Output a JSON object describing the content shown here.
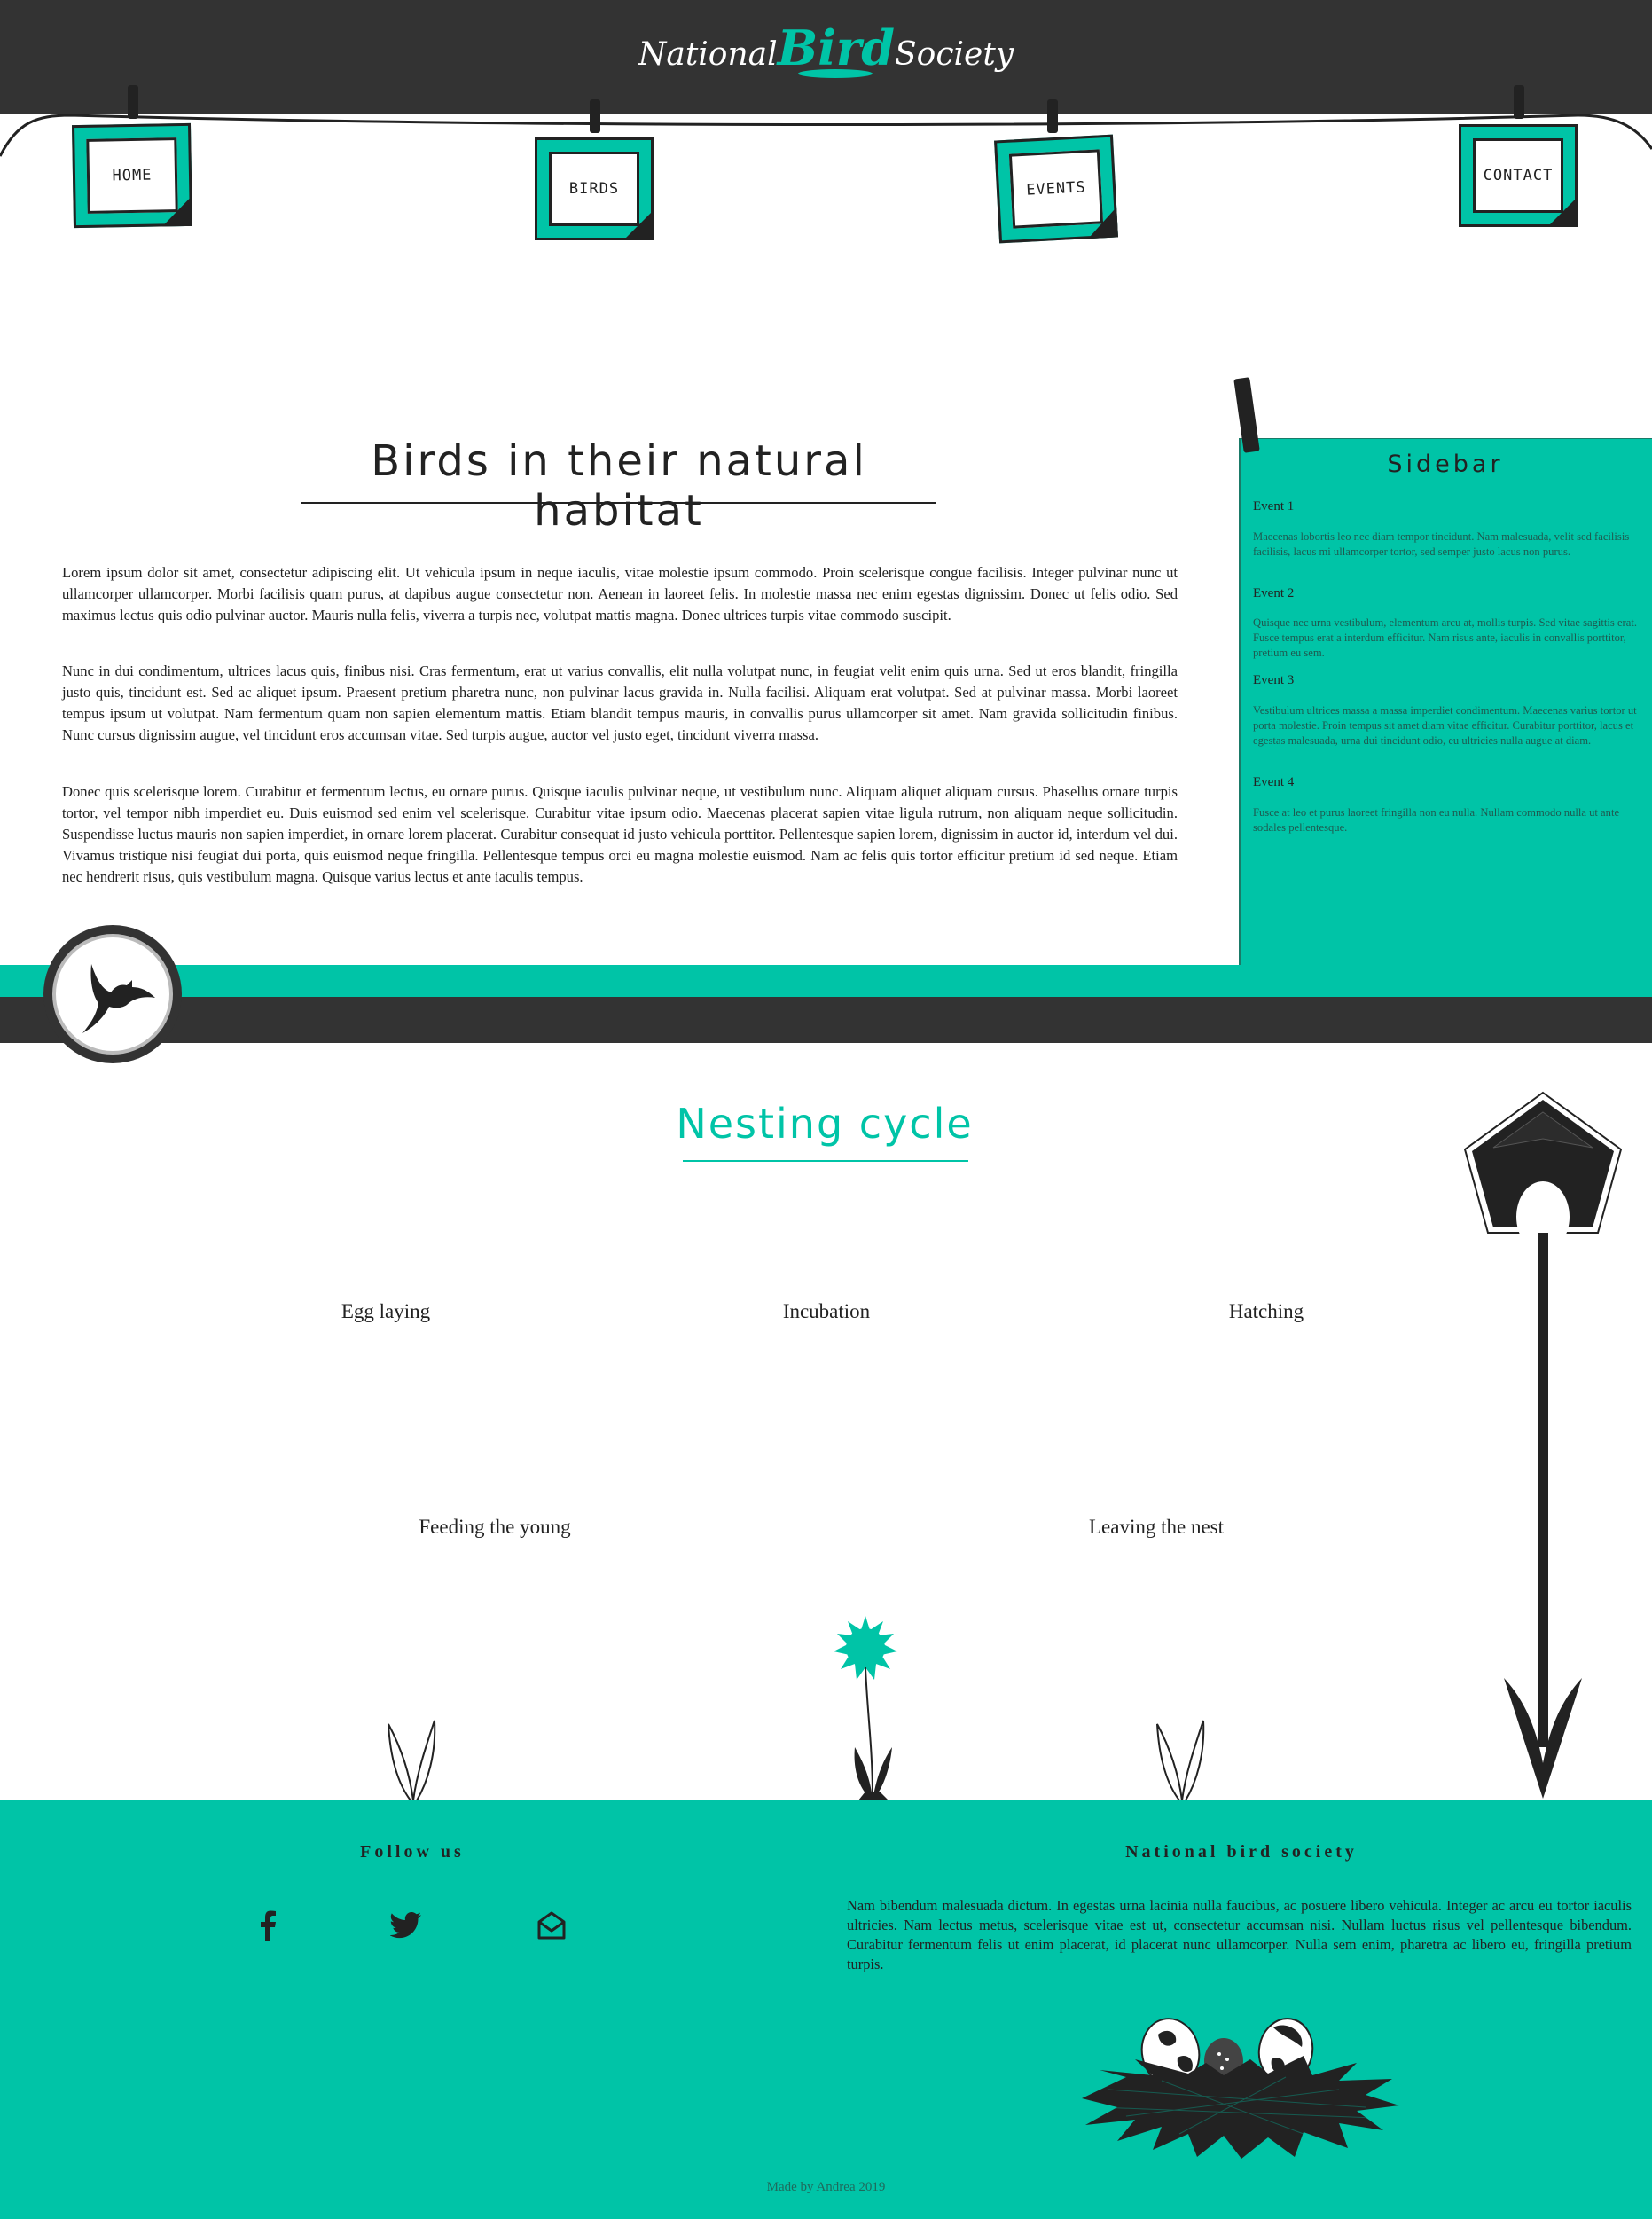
{
  "colors": {
    "accent": "#00c4a7",
    "dark": "#333333",
    "ink": "#222222"
  },
  "header": {
    "logo_part1": "National",
    "logo_part2": "Bird",
    "logo_part3": "Society"
  },
  "nav": {
    "items": [
      {
        "label": "HOME"
      },
      {
        "label": "BIRDS"
      },
      {
        "label": "EVENTS"
      },
      {
        "label": "CONTACT"
      }
    ]
  },
  "main": {
    "title": "Birds in their natural habitat",
    "paragraphs": [
      "Lorem ipsum dolor sit amet, consectetur adipiscing elit. Ut vehicula ipsum in neque iaculis, vitae molestie ipsum commodo. Proin scelerisque congue facilisis. Integer pulvinar nunc ut ullamcorper ullamcorper. Morbi facilisis quam purus, at dapibus augue consectetur non. Aenean in laoreet felis. In molestie massa nec enim egestas dignissim. Donec ut felis odio. Sed maximus lectus quis odio pulvinar auctor. Mauris nulla felis, viverra a turpis nec, volutpat mattis magna. Donec ultrices turpis vitae commodo suscipit.",
      "Nunc in dui condimentum, ultrices lacus quis, finibus nisi. Cras fermentum, erat ut varius convallis, elit nulla volutpat nunc, in feugiat velit enim quis urna. Sed ut eros blandit, fringilla justo quis, tincidunt est. Sed ac aliquet ipsum. Praesent pretium pharetra nunc, non pulvinar lacus gravida in. Nulla facilisi. Aliquam erat volutpat. Sed at pulvinar massa. Morbi laoreet tempus ipsum ut volutpat. Nam fermentum quam non sapien elementum mattis. Etiam blandit tempus mauris, in convallis purus ullamcorper sit amet. Nam gravida sollicitudin finibus. Nunc cursus dignissim augue, vel tincidunt eros accumsan vitae. Sed turpis augue, auctor vel justo eget, tincidunt viverra massa.",
      "Donec quis scelerisque lorem. Curabitur et fermentum lectus, eu ornare purus. Quisque iaculis pulvinar neque, ut vestibulum nunc. Aliquam aliquet aliquam cursus. Phasellus ornare turpis tortor, vel tempor nibh imperdiet eu. Duis euismod sed enim vel scelerisque. Curabitur vitae ipsum odio. Maecenas placerat sapien vitae ligula rutrum, non aliquam neque sollicitudin. Suspendisse luctus mauris non sapien imperdiet, in ornare lorem placerat. Curabitur consequat id justo vehicula porttitor. Pellentesque sapien lorem, dignissim in auctor id, interdum vel dui. Vivamus tristique nisi feugiat dui porta, quis euismod neque fringilla. Pellentesque tempus orci eu magna molestie euismod. Nam ac felis quis tortor efficitur pretium id sed neque. Etiam nec hendrerit risus, quis vestibulum magna. Quisque varius lectus et ante iaculis tempus."
    ]
  },
  "sidebar": {
    "title": "Sidebar",
    "events": [
      {
        "title": "Event 1",
        "text": "Maecenas lobortis leo nec diam tempor tincidunt. Nam malesuada, velit sed facilisis facilisis, lacus mi ullamcorper tortor, sed semper justo lacus non purus."
      },
      {
        "title": "Event 2",
        "text": "Quisque nec urna vestibulum, elementum arcu at, mollis turpis. Sed vitae sagittis erat. Fusce tempus erat a interdum efficitur. Nam risus ante, iaculis in convallis porttitor, pretium eu sem."
      },
      {
        "title": "Event 3",
        "text": "Vestibulum ultrices massa a massa imperdiet condimentum. Maecenas varius tortor ut porta molestie. Proin tempus sit amet diam vitae efficitur. Curabitur porttitor, lacus et egestas malesuada, urna dui tincidunt odio, eu ultricies nulla augue at diam."
      },
      {
        "title": "Event 4",
        "text": "Fusce at leo et purus laoreet fringilla non eu nulla. Nullam commodo nulla ut ante sodales pellentesque."
      }
    ]
  },
  "nesting": {
    "title": "Nesting cycle",
    "stages": [
      "Egg laying",
      "Incubation",
      "Hatching",
      "Feeding the young",
      "Leaving the nest"
    ]
  },
  "footer": {
    "follow_title": "Follow us",
    "social": [
      {
        "icon": "facebook-icon"
      },
      {
        "icon": "twitter-icon"
      },
      {
        "icon": "mail-icon"
      }
    ],
    "society_title": "National bird society",
    "society_text": "Nam bibendum malesuada dictum. In egestas urna lacinia nulla faucibus, ac posuere libero vehicula. Integer ac arcu eu tortor iaculis ultricies. Nam lectus metus, scelerisque vitae est ut, consectetur accumsan nisi. Nullam luctus risus vel pellentesque bibendum. Curabitur fermentum felis ut enim placerat, id placerat nunc ullamcorper. Nulla sem enim, pharetra ac libero eu, fringilla pretium turpis.",
    "credit": "Made by Andrea 2019"
  }
}
